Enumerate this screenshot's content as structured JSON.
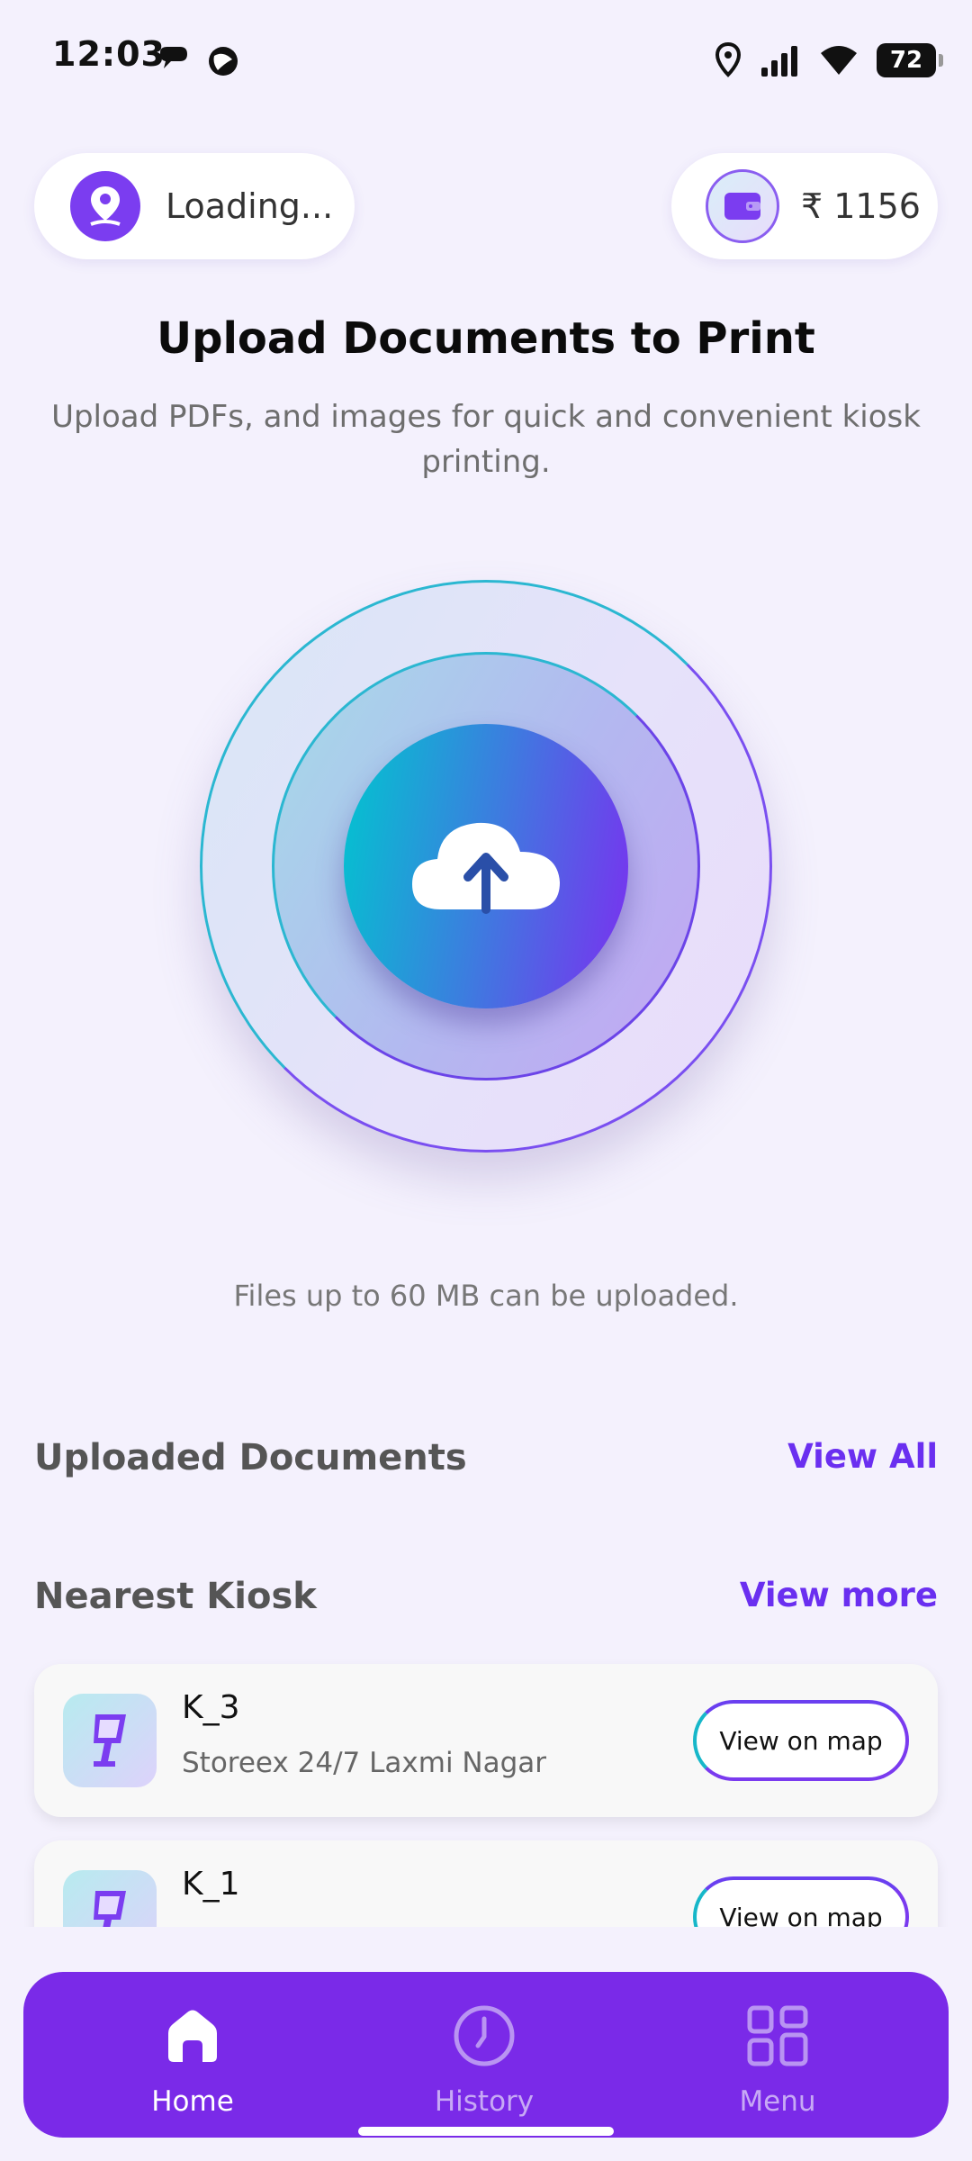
{
  "status_bar": {
    "time": "12:03",
    "battery": "72"
  },
  "location": {
    "text": "Loading..."
  },
  "wallet": {
    "amount": "₹ 1156"
  },
  "header": {
    "title": "Upload Documents to Print",
    "subtitle": "Upload PDFs, and images for quick and convenient kiosk printing."
  },
  "upload": {
    "note": "Files up to 60 MB can be uploaded."
  },
  "uploaded_section": {
    "title": "Uploaded Documents",
    "link": "View All"
  },
  "kiosk_section": {
    "title": "Nearest Kiosk",
    "link": "View more",
    "items": [
      {
        "name": "K_3",
        "address": "Storeex 24/7 Laxmi Nagar",
        "button": "View on map"
      },
      {
        "name": "K_1",
        "address": "",
        "button": "View on map"
      }
    ]
  },
  "nav": {
    "items": [
      {
        "label": "Home",
        "icon": "home-icon",
        "active": true
      },
      {
        "label": "History",
        "icon": "clock-icon",
        "active": false
      },
      {
        "label": "Menu",
        "icon": "grid-icon",
        "active": false
      }
    ]
  },
  "colors": {
    "accent": "#7a2ae8",
    "link": "#6a2ff0",
    "background": "#f4f1fd"
  }
}
